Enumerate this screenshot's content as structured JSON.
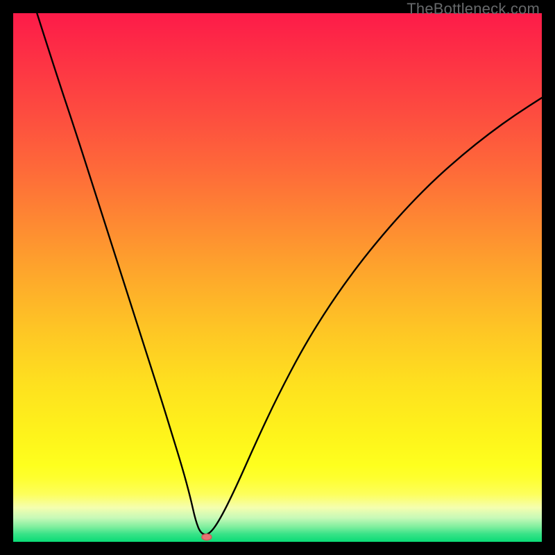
{
  "watermark": "TheBottleneck.com",
  "chart_data": {
    "type": "line",
    "title": "",
    "xlabel": "",
    "ylabel": "",
    "xlim": [
      0,
      100
    ],
    "ylim": [
      0,
      100
    ],
    "grid": false,
    "series": [
      {
        "name": "curve",
        "stroke": "#000000",
        "x": [
          4.5,
          8,
          12,
          16,
          20,
          24,
          28,
          30,
          32,
          33.5,
          34.5,
          35.5,
          37,
          39,
          42,
          46,
          50,
          55,
          60,
          65,
          70,
          75,
          80,
          85,
          90,
          95,
          100
        ],
        "y": [
          100,
          89,
          77,
          64.5,
          52,
          39.5,
          27,
          20.5,
          14,
          8.5,
          4,
          1.5,
          1.3,
          4,
          10,
          19,
          27.5,
          37,
          45,
          52,
          58.2,
          63.8,
          68.8,
          73.2,
          77.2,
          80.8,
          84
        ]
      }
    ],
    "gradient_stops": [
      {
        "offset": 0.0,
        "color": "#fd1b49"
      },
      {
        "offset": 0.1,
        "color": "#fd3544"
      },
      {
        "offset": 0.2,
        "color": "#fd4f3f"
      },
      {
        "offset": 0.3,
        "color": "#fe6b39"
      },
      {
        "offset": 0.4,
        "color": "#fe8a32"
      },
      {
        "offset": 0.5,
        "color": "#fea92b"
      },
      {
        "offset": 0.6,
        "color": "#fec625"
      },
      {
        "offset": 0.7,
        "color": "#fee01f"
      },
      {
        "offset": 0.8,
        "color": "#fef41b"
      },
      {
        "offset": 0.855,
        "color": "#feff1e"
      },
      {
        "offset": 0.88,
        "color": "#feff30"
      },
      {
        "offset": 0.91,
        "color": "#fdff5c"
      },
      {
        "offset": 0.935,
        "color": "#f5feae"
      },
      {
        "offset": 0.955,
        "color": "#c6f9b7"
      },
      {
        "offset": 0.972,
        "color": "#7eee9e"
      },
      {
        "offset": 0.985,
        "color": "#39e388"
      },
      {
        "offset": 1.0,
        "color": "#0adb76"
      }
    ],
    "marker": {
      "x": 36.6,
      "y": 0.9,
      "color_fill": "#e57373",
      "color_stroke": "#cf5a5a",
      "rx": 7,
      "ry": 4.5
    }
  }
}
